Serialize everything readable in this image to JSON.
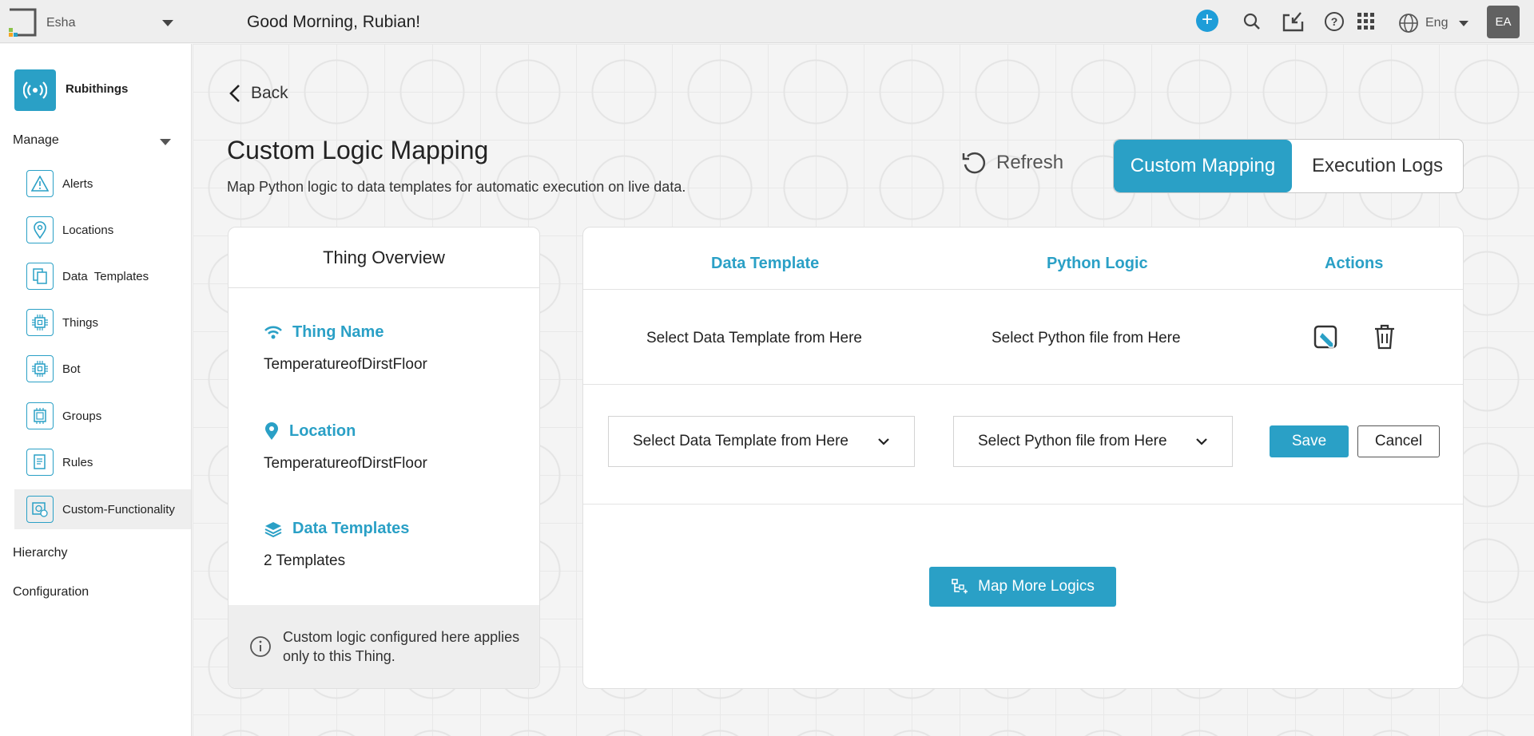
{
  "topbar": {
    "tenant_name": "Esha",
    "greeting": "Good Morning,  Rubian!",
    "language": "Eng",
    "avatar_initials": "EA"
  },
  "sidebar": {
    "app_name": "Rubithings",
    "manage_label": "Manage",
    "items": [
      {
        "label": "Alerts",
        "icon": "warning-icon"
      },
      {
        "label": "Locations",
        "icon": "location-pin-icon"
      },
      {
        "label": "Data  Templates",
        "icon": "templates-icon"
      },
      {
        "label": "Things",
        "icon": "chip-icon"
      },
      {
        "label": "Bot",
        "icon": "chip-icon"
      },
      {
        "label": "Groups",
        "icon": "groups-icon"
      },
      {
        "label": "Rules",
        "icon": "rules-icon"
      },
      {
        "label": "Custom-Functionality",
        "icon": "custom-functionality-icon"
      }
    ],
    "hierarchy_label": "Hierarchy",
    "configuration_label": "Configuration"
  },
  "page": {
    "back_label": "Back",
    "title": "Custom Logic Mapping",
    "subtitle": "Map Python logic to data templates for automatic execution on live data.",
    "refresh_label": "Refresh",
    "tabs": [
      "Custom Mapping",
      "Execution Logs"
    ]
  },
  "overview": {
    "title": "Thing Overview",
    "thing_name_label": "Thing Name",
    "thing_name_value": "TemperatureofDirstFloor",
    "location_label": "Location",
    "location_value": "TemperatureofDirstFloor",
    "templates_label": "Data Templates",
    "templates_value": "2 Templates",
    "note": "Custom logic configured here applies only to this Thing."
  },
  "mapping": {
    "headers": {
      "data_template": "Data Template",
      "python_logic": "Python Logic",
      "actions": "Actions"
    },
    "row": {
      "data_template": "Select Data Template from Here",
      "python_logic": "Select Python file from Here"
    },
    "edit_row": {
      "template_select": "Select Data Template from Here",
      "python_select": "Select Python file from Here",
      "save_label": "Save",
      "cancel_label": "Cancel"
    },
    "map_more_label": "Map More Logics"
  },
  "colors": {
    "accent": "#2aa0c6",
    "plus": "#1e9dd8"
  }
}
